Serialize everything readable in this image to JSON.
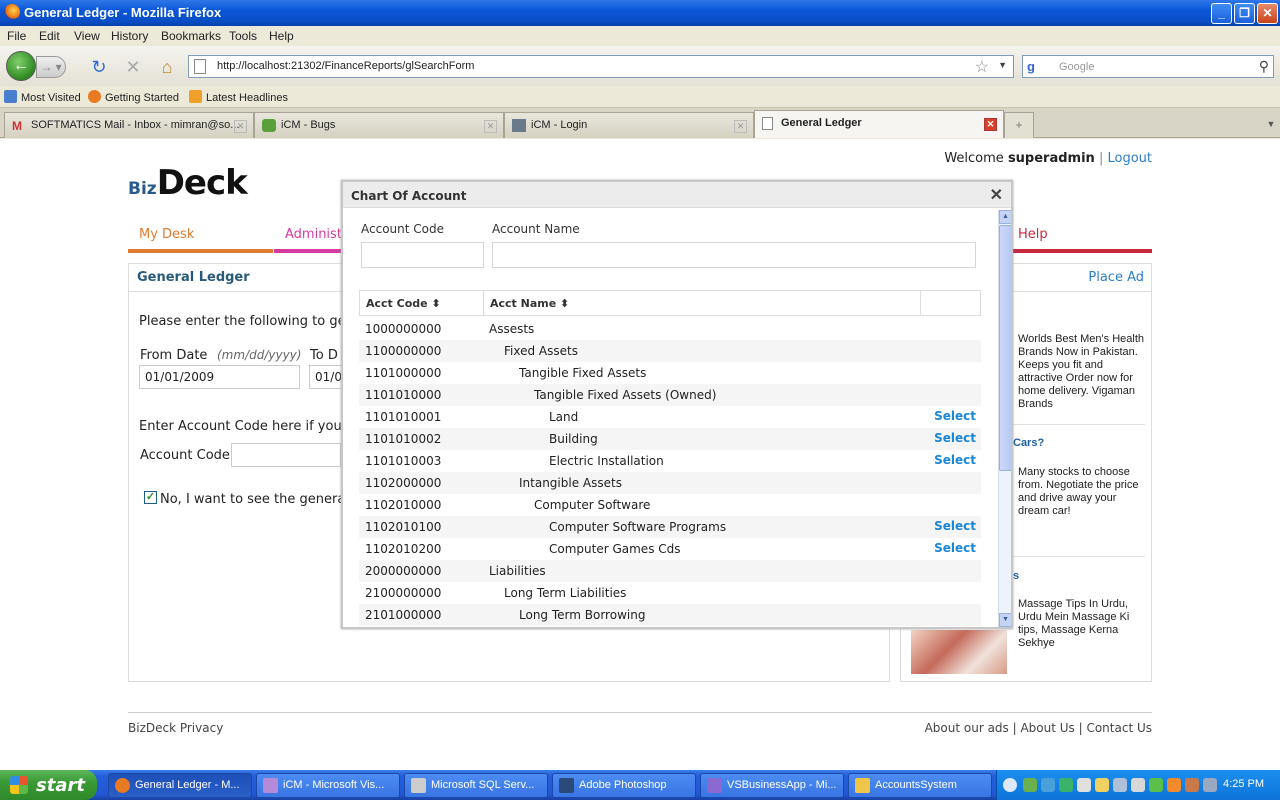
{
  "window": {
    "title": "General Ledger - Mozilla Firefox",
    "btn_min": "_",
    "btn_max": "❐",
    "btn_close": "✕"
  },
  "menu": [
    "File",
    "Edit",
    "View",
    "History",
    "Bookmarks",
    "Tools",
    "Help"
  ],
  "nav": {
    "url": "http://localhost:21302/FinanceReports/glSearchForm",
    "search_placeholder": "Google",
    "search_engine_glyph": "g"
  },
  "bookmarks": [
    "Most Visited",
    "Getting Started",
    "Latest Headlines"
  ],
  "tabs": [
    "SOFTMATICS Mail - Inbox - mimran@so...",
    "iCM - Bugs",
    "iCM - Login",
    "General Ledger"
  ],
  "page": {
    "welcome_prefix": "Welcome",
    "username": "superadmin",
    "separator": "|",
    "logout": "Logout",
    "logo_biz": "Biz",
    "logo_deck": "Deck",
    "nav_tabs": [
      {
        "label": "My Desk",
        "color": "#e07a2e"
      },
      {
        "label": "Administ",
        "color": "#d63aa0"
      },
      {
        "label": "Help",
        "color": "#c8283c"
      }
    ],
    "panel_title": "General Ledger",
    "place_ad": "Place Ad",
    "intro": "Please enter the following to ge",
    "from_date_label": "From Date",
    "date_format": "(mm/dd/yyyy)",
    "to_date_label": "To D",
    "from_date_value": "01/01/2009",
    "to_date_value": "01/0",
    "account_hint": "Enter Account Code here if you",
    "account_code_label": "Account Code",
    "checkbox_label": "No, I want to see the genera",
    "ads": {
      "ad1_text": "Worlds Best Men's Health Brands Now in Pakistan. Keeps you fit and attractive Order now for home delivery. Vigaman Brands",
      "ad2_title": "Cars?",
      "ad2_text": "Many stocks to choose from. Negotiate the price and drive away your dream car!",
      "ad3_title": "s",
      "ad3_text": "Massage Tips In Urdu, Urdu Mein Massage Ki tips, Massage Kerna Sekhye"
    },
    "footer_left": "BizDeck Privacy",
    "footer_right": "About our ads  |  About Us  |  Contact Us"
  },
  "modal": {
    "title": "Chart Of Account",
    "close": "✕",
    "account_code_label": "Account Code",
    "account_name_label": "Account Name",
    "col_code": "Acct Code",
    "col_name": "Acct Name",
    "sort_glyph": "⬍",
    "select_label": "Select",
    "rows": [
      {
        "code": "1000000000",
        "name": "Assests",
        "level": 0,
        "selectable": false
      },
      {
        "code": "1100000000",
        "name": "Fixed Assets",
        "level": 1,
        "selectable": false
      },
      {
        "code": "1101000000",
        "name": "Tangible Fixed Assets",
        "level": 2,
        "selectable": false
      },
      {
        "code": "1101010000",
        "name": "Tangible Fixed Assets (Owned)",
        "level": 3,
        "selectable": false
      },
      {
        "code": "1101010001",
        "name": "Land",
        "level": 4,
        "selectable": true
      },
      {
        "code": "1101010002",
        "name": "Building",
        "level": 4,
        "selectable": true
      },
      {
        "code": "1101010003",
        "name": "Electric Installation",
        "level": 4,
        "selectable": true
      },
      {
        "code": "1102000000",
        "name": "Intangible Assets",
        "level": 2,
        "selectable": false
      },
      {
        "code": "1102010000",
        "name": "Computer Software",
        "level": 3,
        "selectable": false
      },
      {
        "code": "1102010100",
        "name": "Computer Software Programs",
        "level": 4,
        "selectable": true
      },
      {
        "code": "1102010200",
        "name": "Computer Games Cds",
        "level": 4,
        "selectable": true
      },
      {
        "code": "2000000000",
        "name": "Liabilities",
        "level": 0,
        "selectable": false
      },
      {
        "code": "2100000000",
        "name": "Long Term Liabilities",
        "level": 1,
        "selectable": false
      },
      {
        "code": "2101000000",
        "name": "Long Term Borrowing",
        "level": 2,
        "selectable": false
      }
    ]
  },
  "taskbar": {
    "start": "start",
    "tasks": [
      "General Ledger - M...",
      "iCM - Microsoft Vis...",
      "Microsoft SQL Serv...",
      "Adobe Photoshop",
      "VSBusinessApp - Mi...",
      "AccountsSystem"
    ],
    "clock": "4:25 PM"
  }
}
